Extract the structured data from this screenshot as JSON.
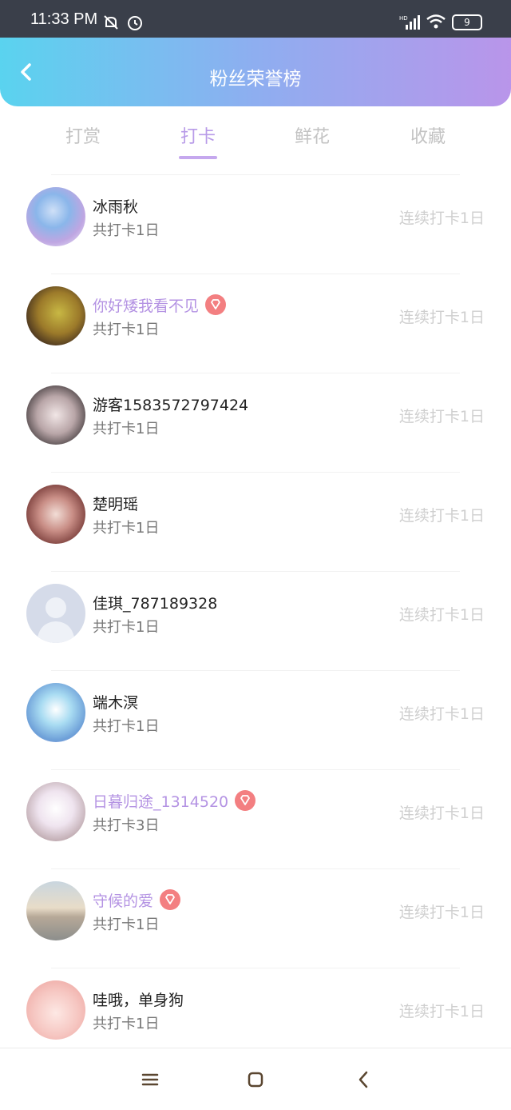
{
  "status": {
    "time": "11:33 PM",
    "battery": "9"
  },
  "header": {
    "title": "粉丝荣誉榜"
  },
  "tabs": [
    {
      "label": "打赏",
      "active": false
    },
    {
      "label": "打卡",
      "active": true
    },
    {
      "label": "鲜花",
      "active": false
    },
    {
      "label": "收藏",
      "active": false
    }
  ],
  "rows": [
    {
      "name": "冰雨秋",
      "vip": false,
      "sub": "共打卡1日",
      "right": "连续打卡1日",
      "avatar": "anime-girl-blue"
    },
    {
      "name": "你好矮我看不见",
      "vip": true,
      "sub": "共打卡1日",
      "right": "连续打卡1日",
      "avatar": "person-yellow-jacket"
    },
    {
      "name": "游客1583572797424",
      "vip": false,
      "sub": "共打卡1日",
      "right": "连续打卡1日",
      "avatar": "anime-man-dark"
    },
    {
      "name": "楚明瑶",
      "vip": false,
      "sub": "共打卡1日",
      "right": "连续打卡1日",
      "avatar": "girl-red-tones"
    },
    {
      "name": "佳琪_787189328",
      "vip": false,
      "sub": "共打卡1日",
      "right": "连续打卡1日",
      "avatar": "default-user"
    },
    {
      "name": "端木溟",
      "vip": false,
      "sub": "共打卡1日",
      "right": "连续打卡1日",
      "avatar": "anime-blue-white"
    },
    {
      "name": "日暮归途_1314520",
      "vip": true,
      "sub": "共打卡3日",
      "right": "连续打卡1日",
      "avatar": "girl-pink-white"
    },
    {
      "name": "守候的爱",
      "vip": true,
      "sub": "共打卡1日",
      "right": "连续打卡1日",
      "avatar": "seaside-sunset"
    },
    {
      "name": "哇哦，单身狗",
      "vip": false,
      "sub": "共打卡1日",
      "right": "连续打卡1日",
      "avatar": "pink-cartoon"
    }
  ],
  "colors": {
    "accent": "#b89be8",
    "vip_badge": "#f37f81",
    "vip_name": "#b493e3"
  }
}
